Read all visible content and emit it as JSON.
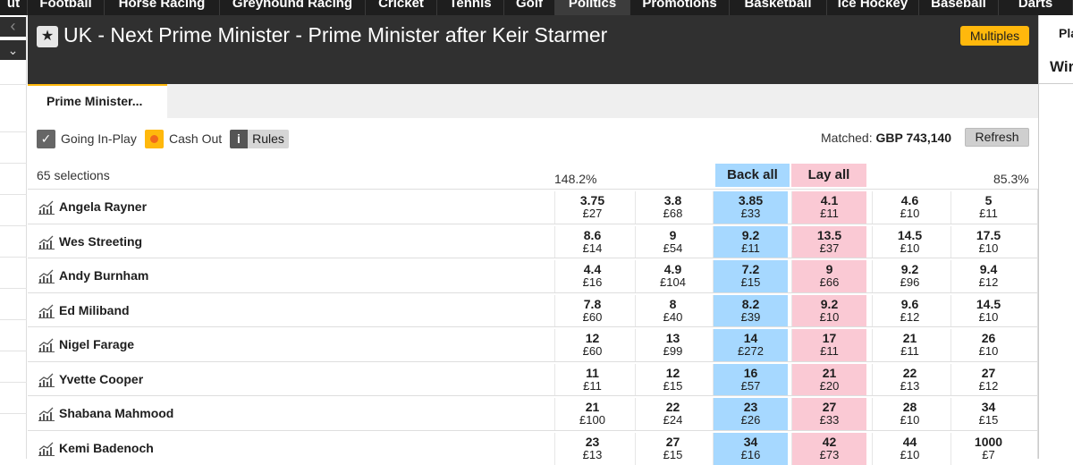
{
  "nav": {
    "tabs": [
      {
        "label": "ut"
      },
      {
        "label": "Football"
      },
      {
        "label": "Horse Racing"
      },
      {
        "label": "Greyhound Racing"
      },
      {
        "label": "Cricket"
      },
      {
        "label": "Tennis"
      },
      {
        "label": "Golf"
      },
      {
        "label": "Politics"
      },
      {
        "label": "Promotions"
      },
      {
        "label": "Basketball"
      },
      {
        "label": "Ice Hockey"
      },
      {
        "label": "Baseball"
      },
      {
        "label": "Darts"
      }
    ]
  },
  "left_gutter": {
    "back_icon": "chevron-left-icon",
    "down_icon": "chevron-down-icon"
  },
  "header": {
    "title": "UK - Next Prime Minister - Prime Minister after Keir Starmer",
    "star_icon": "star-icon",
    "multiples_label": "Multiples"
  },
  "right_panel": {
    "pla": "Pla",
    "win": "Wir"
  },
  "tabs": {
    "active_label": "Prime Minister..."
  },
  "controls": {
    "going_inplay_label": "Going In-Play",
    "cashout_label": "Cash Out",
    "info_label": "i",
    "rules_label": "Rules",
    "matched_label": "Matched:",
    "matched_value": "GBP 743,140",
    "refresh_label": "Refresh"
  },
  "market": {
    "selections_label": "65 selections",
    "back_pct": "148.2%",
    "lay_pct": "85.3%",
    "back_all_label": "Back all",
    "lay_all_label": "Lay all",
    "colors": {
      "back": "#a6d8ff",
      "lay": "#fac9d4",
      "accent": "#ffb80c"
    },
    "runners": [
      {
        "name": "Angela Rayner",
        "prices": [
          [
            "3.75",
            "£27"
          ],
          [
            "3.8",
            "£68"
          ],
          [
            "3.85",
            "£33"
          ],
          [
            "4.1",
            "£11"
          ],
          [
            "4.6",
            "£10"
          ],
          [
            "5",
            "£11"
          ]
        ]
      },
      {
        "name": "Wes Streeting",
        "prices": [
          [
            "8.6",
            "£14"
          ],
          [
            "9",
            "£54"
          ],
          [
            "9.2",
            "£11"
          ],
          [
            "13.5",
            "£37"
          ],
          [
            "14.5",
            "£10"
          ],
          [
            "17.5",
            "£10"
          ]
        ]
      },
      {
        "name": "Andy Burnham",
        "prices": [
          [
            "4.4",
            "£16"
          ],
          [
            "4.9",
            "£104"
          ],
          [
            "7.2",
            "£15"
          ],
          [
            "9",
            "£66"
          ],
          [
            "9.2",
            "£96"
          ],
          [
            "9.4",
            "£12"
          ]
        ]
      },
      {
        "name": "Ed Miliband",
        "prices": [
          [
            "7.8",
            "£60"
          ],
          [
            "8",
            "£40"
          ],
          [
            "8.2",
            "£39"
          ],
          [
            "9.2",
            "£10"
          ],
          [
            "9.6",
            "£12"
          ],
          [
            "14.5",
            "£10"
          ]
        ]
      },
      {
        "name": "Nigel Farage",
        "prices": [
          [
            "12",
            "£60"
          ],
          [
            "13",
            "£99"
          ],
          [
            "14",
            "£272"
          ],
          [
            "17",
            "£11"
          ],
          [
            "21",
            "£11"
          ],
          [
            "26",
            "£10"
          ]
        ]
      },
      {
        "name": "Yvette Cooper",
        "prices": [
          [
            "11",
            "£11"
          ],
          [
            "12",
            "£15"
          ],
          [
            "16",
            "£57"
          ],
          [
            "21",
            "£20"
          ],
          [
            "22",
            "£13"
          ],
          [
            "27",
            "£12"
          ]
        ]
      },
      {
        "name": "Shabana Mahmood",
        "prices": [
          [
            "21",
            "£100"
          ],
          [
            "22",
            "£24"
          ],
          [
            "23",
            "£26"
          ],
          [
            "27",
            "£33"
          ],
          [
            "28",
            "£10"
          ],
          [
            "34",
            "£15"
          ]
        ]
      },
      {
        "name": "Kemi Badenoch",
        "prices": [
          [
            "23",
            "£13"
          ],
          [
            "27",
            "£15"
          ],
          [
            "34",
            "£16"
          ],
          [
            "42",
            "£73"
          ],
          [
            "44",
            "£10"
          ],
          [
            "1000",
            "£7"
          ]
        ]
      }
    ]
  }
}
